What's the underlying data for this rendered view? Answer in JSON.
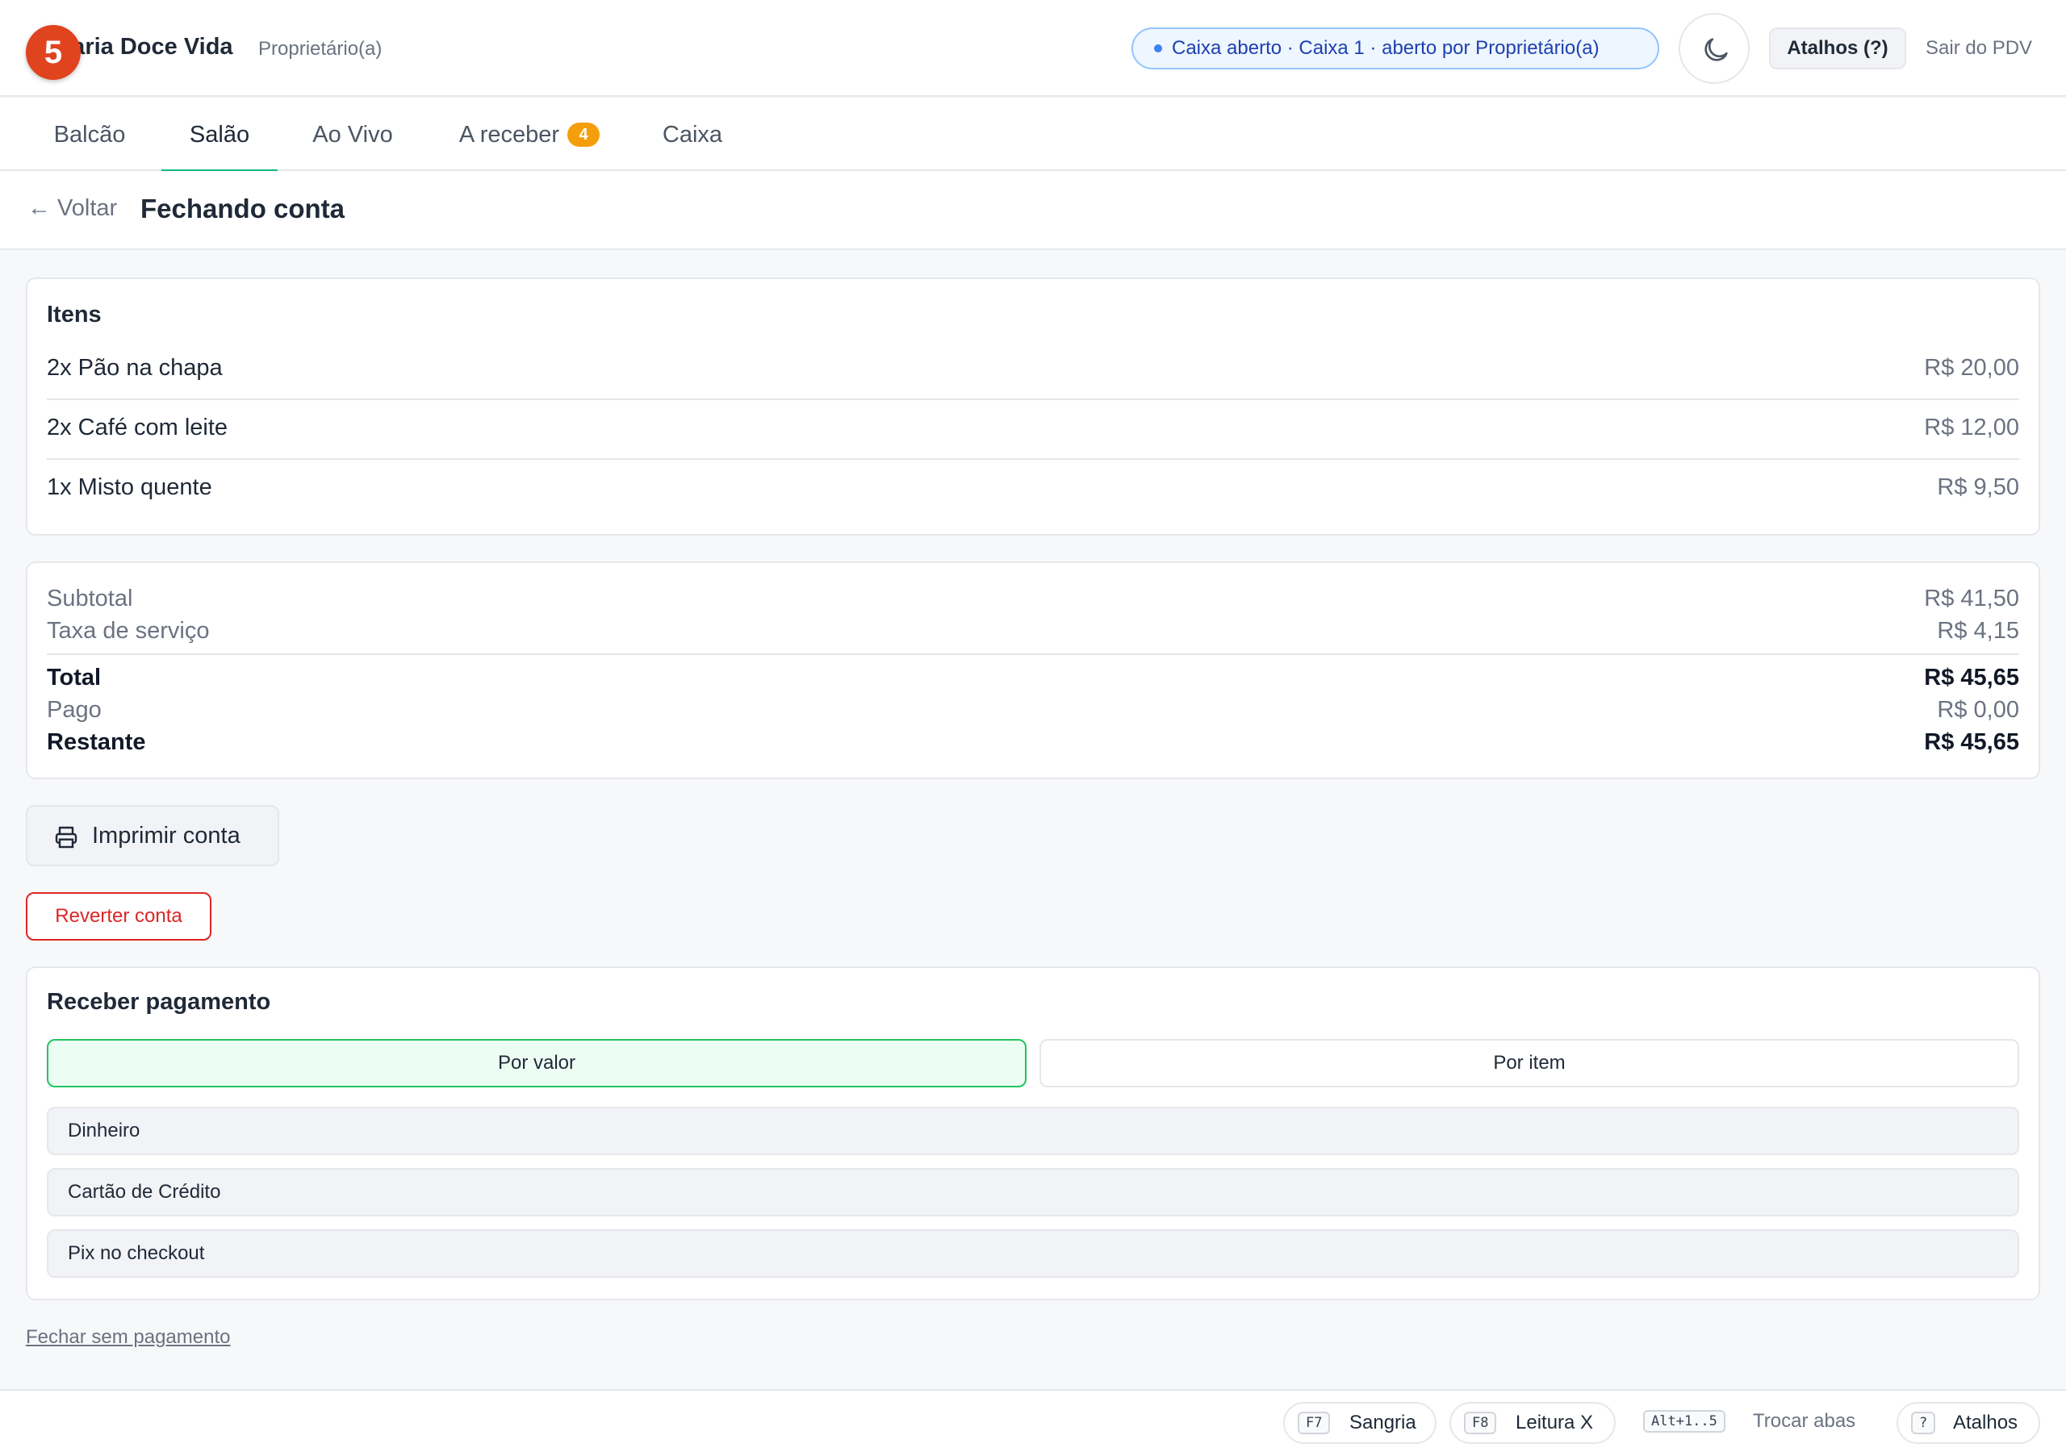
{
  "header": {
    "step_badge": "5",
    "brand": "Padaria Doce Vida",
    "role": "Proprietário(a)",
    "status": "Caixa aberto · Caixa 1 · aberto por Proprietário(a)",
    "shortcuts_label": "Atalhos (?)",
    "exit_label": "Sair do PDV"
  },
  "tabs": [
    {
      "label": "Balcão",
      "active": false
    },
    {
      "label": "Salão",
      "active": true
    },
    {
      "label": "Ao Vivo",
      "active": false
    },
    {
      "label": "A receber",
      "count": "4",
      "active": false
    },
    {
      "label": "Caixa",
      "active": false
    }
  ],
  "subheader": {
    "back_label": "← Voltar",
    "title": "Fechando conta"
  },
  "items_card": {
    "title": "Itens",
    "items": [
      {
        "name": "2x Pão na chapa",
        "price": "R$ 20,00"
      },
      {
        "name": "2x Café com leite",
        "price": "R$ 12,00"
      },
      {
        "name": "1x Misto quente",
        "price": "R$ 9,50"
      }
    ]
  },
  "totals": {
    "subtotal_label": "Subtotal",
    "subtotal": "R$ 41,50",
    "service_label": "Taxa de serviço",
    "service": "R$ 4,15",
    "total_label": "Total",
    "total": "R$ 45,65",
    "paid_label": "Pago",
    "paid": "R$ 0,00",
    "remaining_label": "Restante",
    "remaining": "R$ 45,65"
  },
  "actions": {
    "print_label": "Imprimir conta",
    "revert_label": "Reverter conta",
    "close_without_payment": "Fechar sem pagamento"
  },
  "payment": {
    "title": "Receber pagamento",
    "modes": [
      {
        "label": "Por valor",
        "selected": true
      },
      {
        "label": "Por item",
        "selected": false
      }
    ],
    "methods": [
      "Dinheiro",
      "Cartão de Crédito",
      "Pix no checkout"
    ]
  },
  "footer": {
    "sangria_key": "F7",
    "sangria_label": "Sangria",
    "leitura_key": "F8",
    "leitura_label": "Leitura X",
    "tabs_key": "Alt+1..5",
    "tabs_label": "Trocar abas",
    "help_key": "?",
    "help_label": "Atalhos"
  },
  "colors": {
    "accent_green": "#10b981",
    "danger": "#dc2626",
    "badge_orange": "#f59e0b",
    "step_badge": "#e0441f",
    "status_blue": "#1e40af"
  }
}
